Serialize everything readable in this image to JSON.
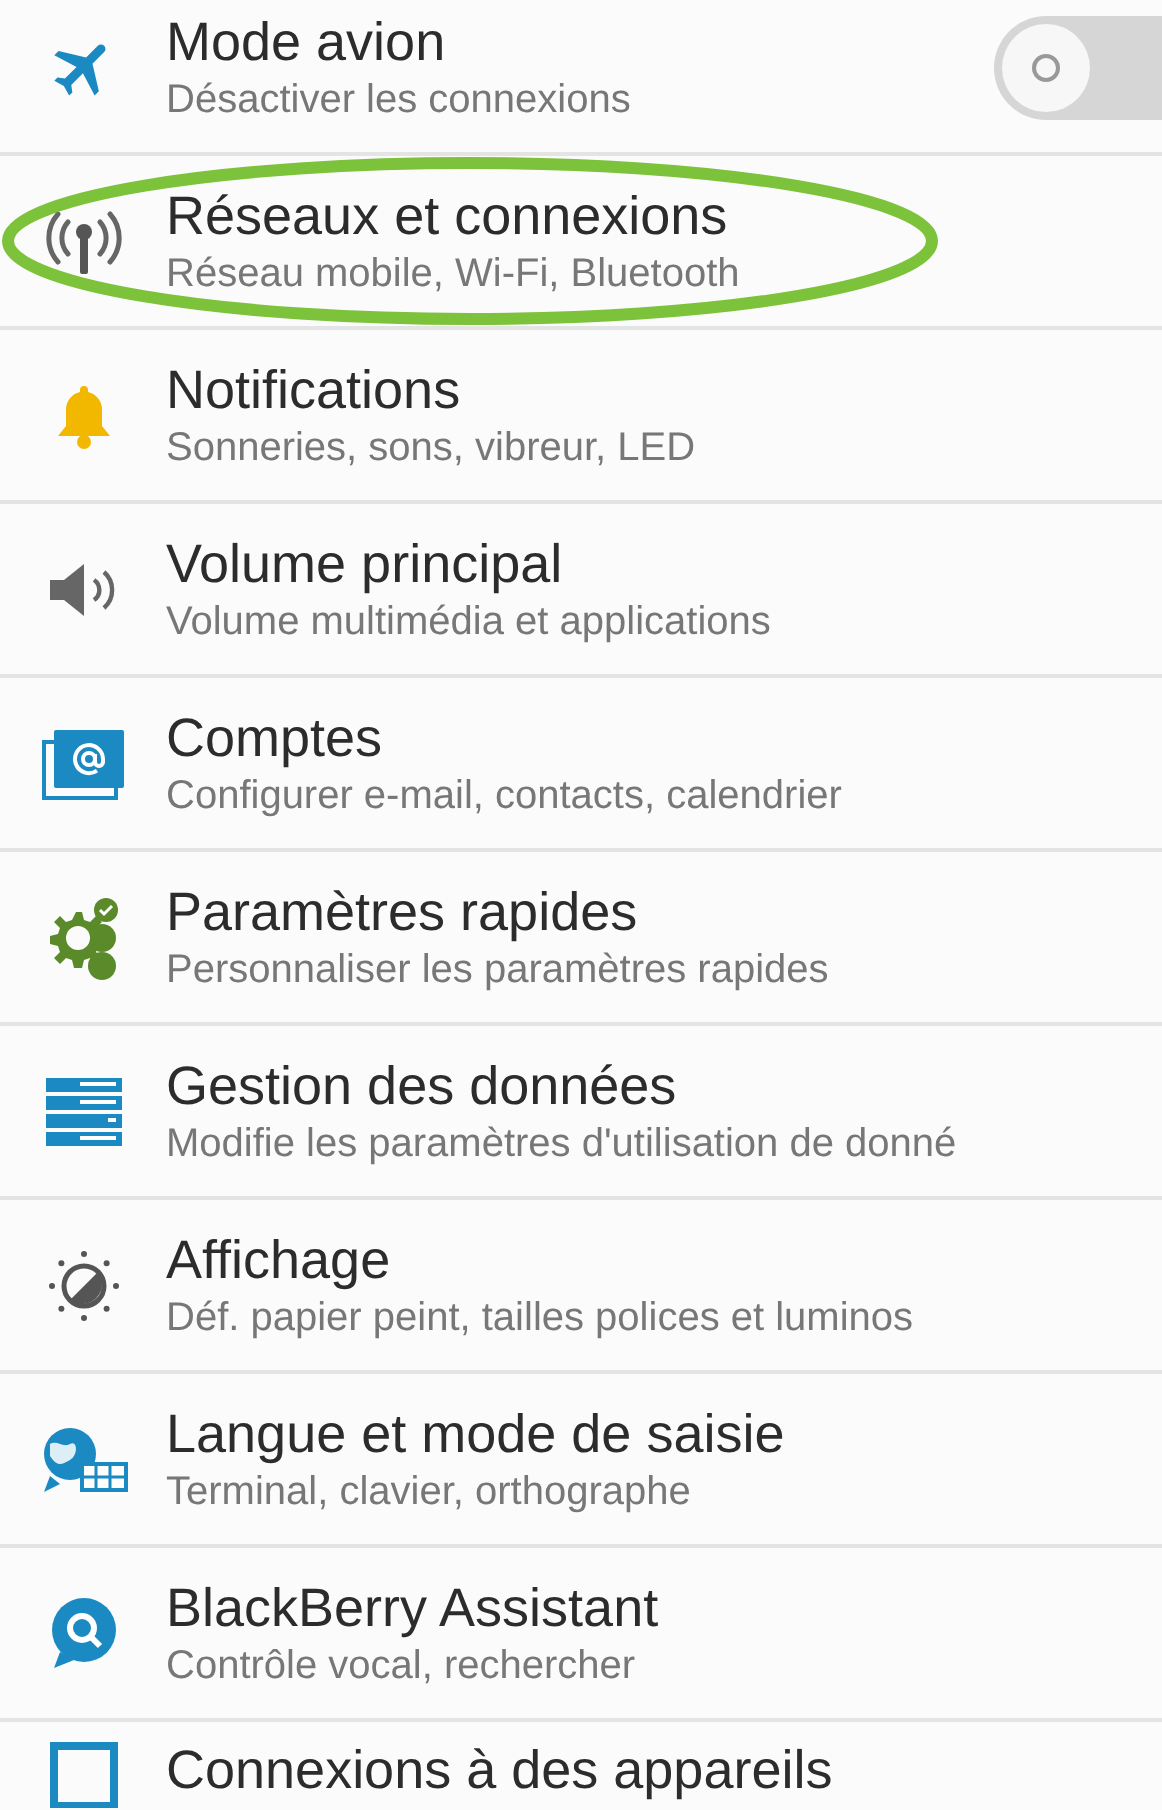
{
  "settings": [
    {
      "title": "Mode avion",
      "subtitle": "Désactiver les connexions",
      "toggle": {
        "on": false
      },
      "highlighted": false
    },
    {
      "title": "Réseaux et connexions",
      "subtitle": "Réseau mobile, Wi-Fi, Bluetooth",
      "highlighted": true
    },
    {
      "title": "Notifications",
      "subtitle": "Sonneries, sons, vibreur, LED",
      "highlighted": false
    },
    {
      "title": "Volume principal",
      "subtitle": "Volume multimédia et applications",
      "highlighted": false
    },
    {
      "title": "Comptes",
      "subtitle": "Configurer e-mail, contacts, calendrier",
      "highlighted": false
    },
    {
      "title": "Paramètres rapides",
      "subtitle": "Personnaliser les paramètres rapides",
      "highlighted": false
    },
    {
      "title": "Gestion des données",
      "subtitle": "Modifie les paramètres d'utilisation de donné",
      "highlighted": false
    },
    {
      "title": "Affichage",
      "subtitle": "Déf. papier peint, tailles polices et luminos",
      "highlighted": false
    },
    {
      "title": "Langue et mode de saisie",
      "subtitle": "Terminal, clavier, orthographe",
      "highlighted": false
    },
    {
      "title": "BlackBerry Assistant",
      "subtitle": "Contrôle vocal, rechercher",
      "highlighted": false
    },
    {
      "title": "Connexions à des appareils",
      "highlighted": false
    }
  ]
}
